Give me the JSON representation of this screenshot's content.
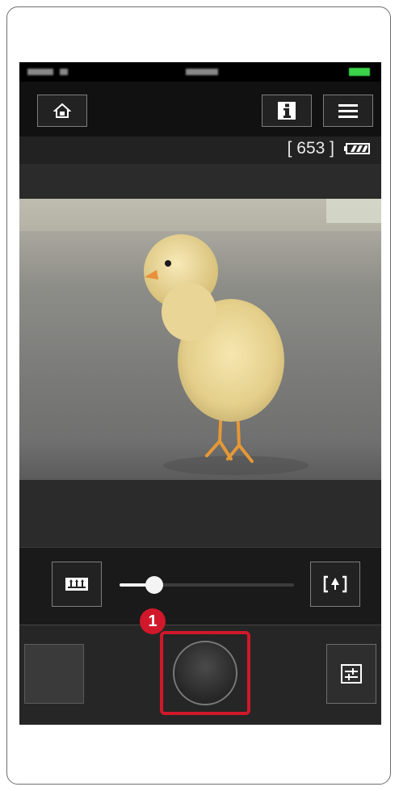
{
  "info_bar": {
    "shots_remaining": "[ 653 ]"
  },
  "callout": {
    "number": "1"
  },
  "zoom_slider": {
    "level": 0.2
  },
  "icons": {
    "home": "home-icon",
    "info": "info-icon",
    "menu": "menu-icon",
    "battery": "battery-icon",
    "zoom_wide": "zoom-wide-icon",
    "zoom_tele": "zoom-tele-icon",
    "settings": "settings-icon"
  },
  "colors": {
    "highlight": "#d0182a",
    "status_battery": "#3bd34a"
  }
}
